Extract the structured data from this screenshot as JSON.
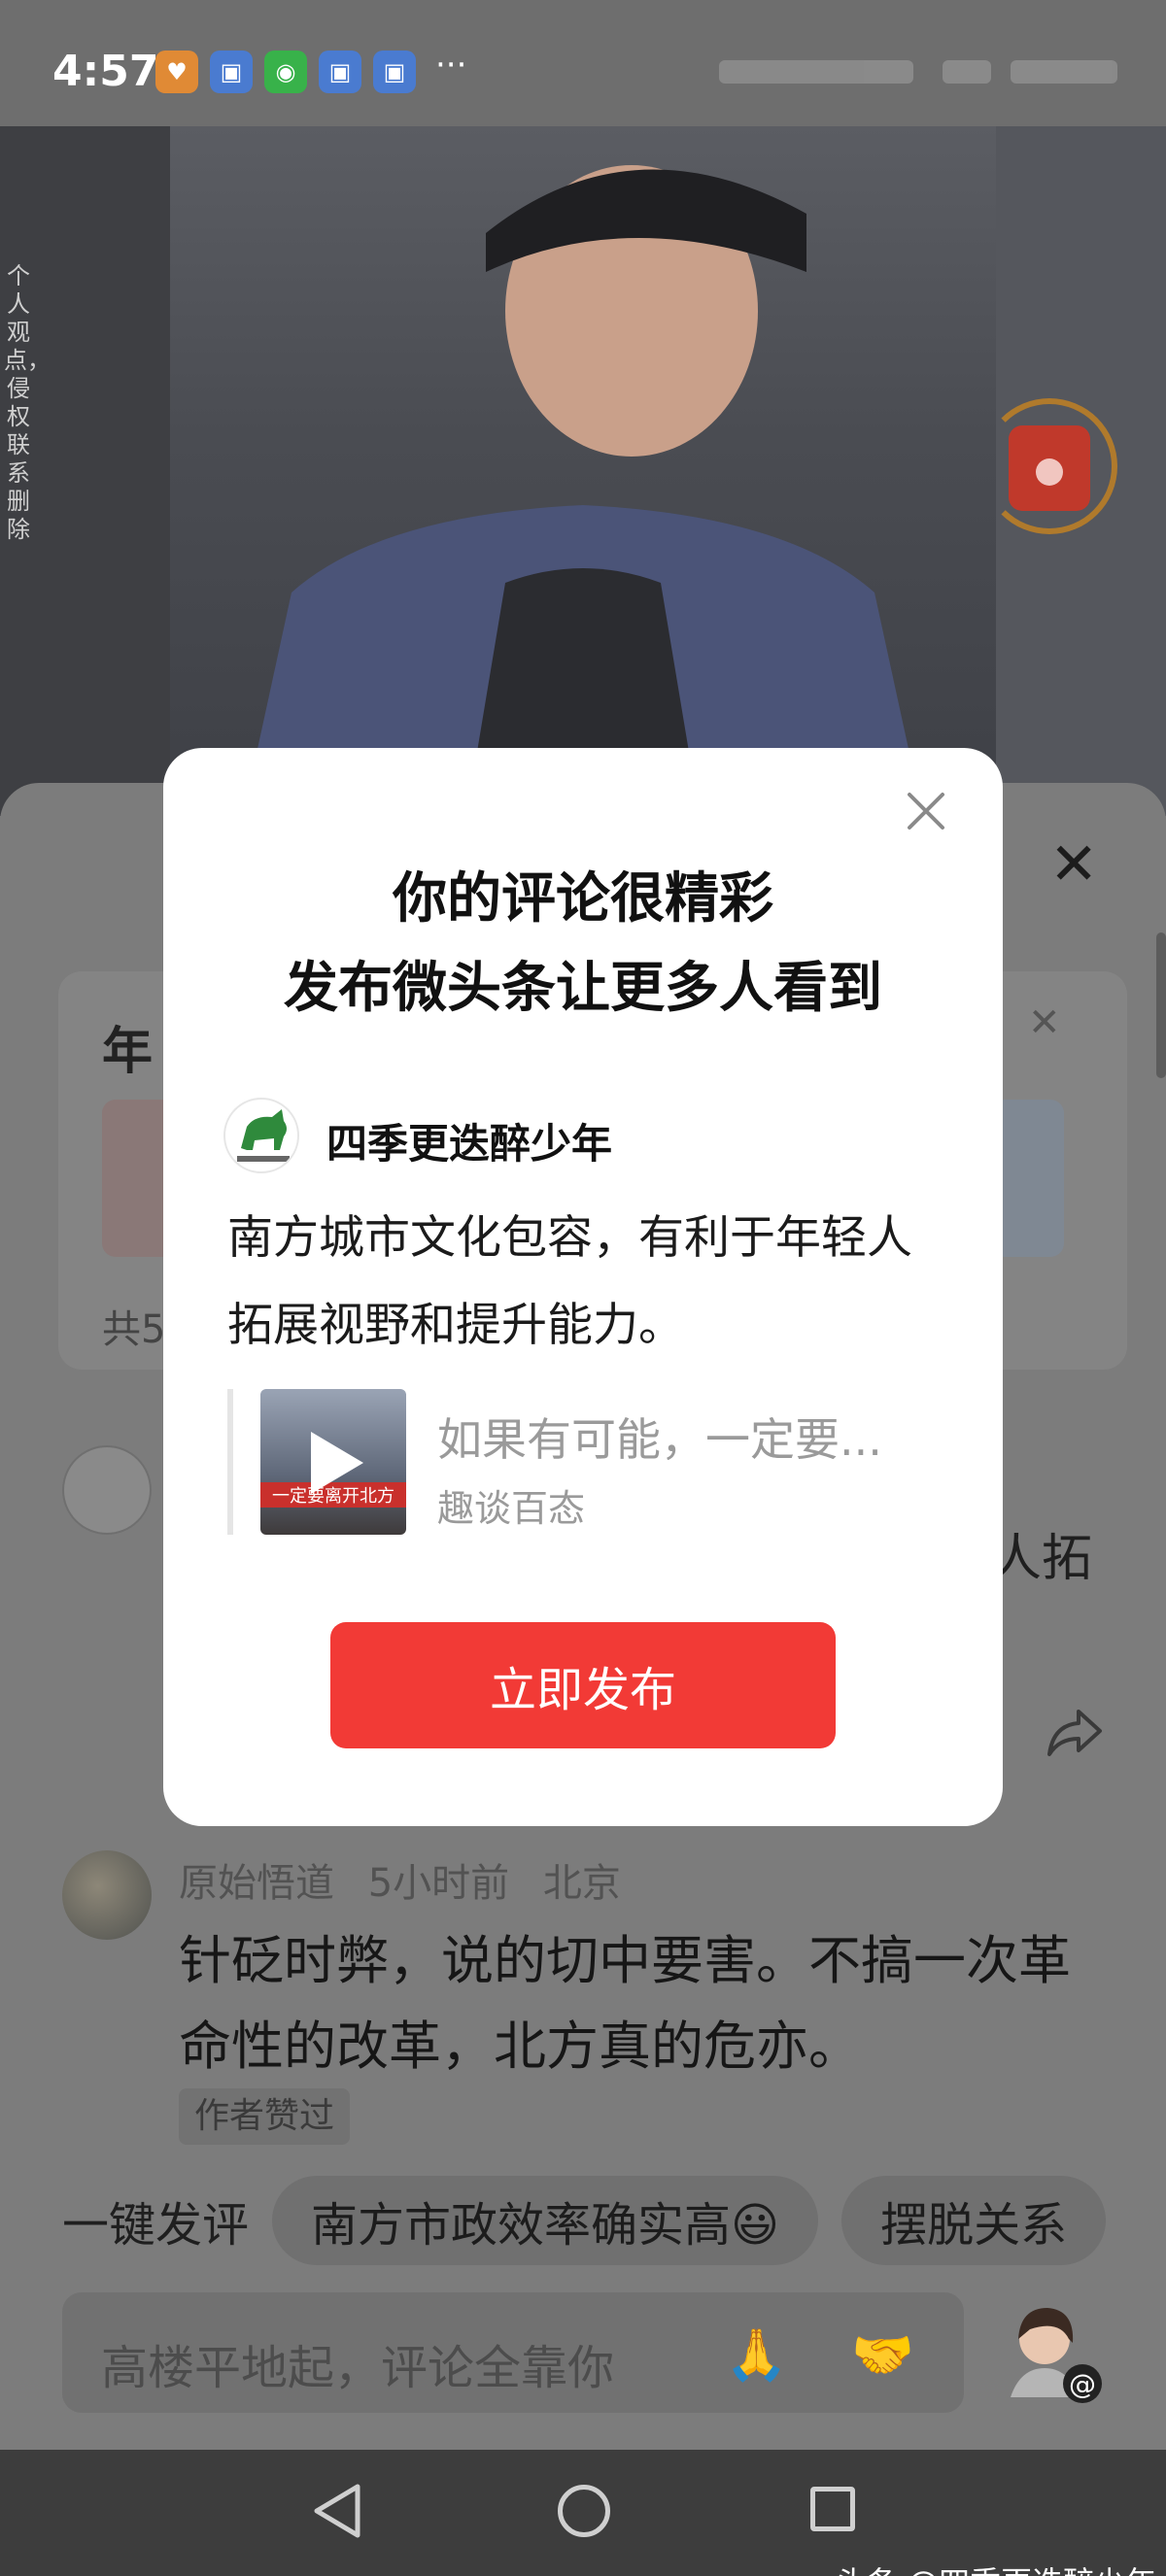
{
  "status_bar": {
    "time": "4:57",
    "more": "···"
  },
  "video": {
    "disclaimer": "个人观点，侵权联系删除"
  },
  "comment_panel": {
    "card": {
      "title": "年",
      "footer": "共5"
    },
    "first_comment": {
      "visible_tail": "人拓"
    },
    "second_comment": {
      "author": "原始悟道",
      "time": "5小时前",
      "location": "北京",
      "text": "针砭时弊，说的切中要害。不搞一次革命性的改革，北方真的危亦。",
      "badge": "作者赞过"
    },
    "quick_reply": {
      "label": "一键发评",
      "chips": [
        "南方市政效率确实高😃",
        "摆脱关系"
      ]
    },
    "input": {
      "placeholder": "高楼平地起，评论全靠你",
      "emoji_1": "🙏",
      "emoji_2": "🤝"
    }
  },
  "modal": {
    "title_line1": "你的评论很精彩",
    "title_line2": "发布微头条让更多人看到",
    "username": "四季更迭醉少年",
    "comment": "南方城市文化包容，有利于年轻人拓展视野和提升能力。",
    "ref_title": "如果有可能，一定要...",
    "ref_source": "趣谈百态",
    "thumb_caption": "一定要离开北方",
    "publish_label": "立即发布"
  },
  "watermark": "头条 @四季更迭醉少年",
  "colors": {
    "accent": "#f23a36",
    "overlay": "#7a7a7a"
  }
}
